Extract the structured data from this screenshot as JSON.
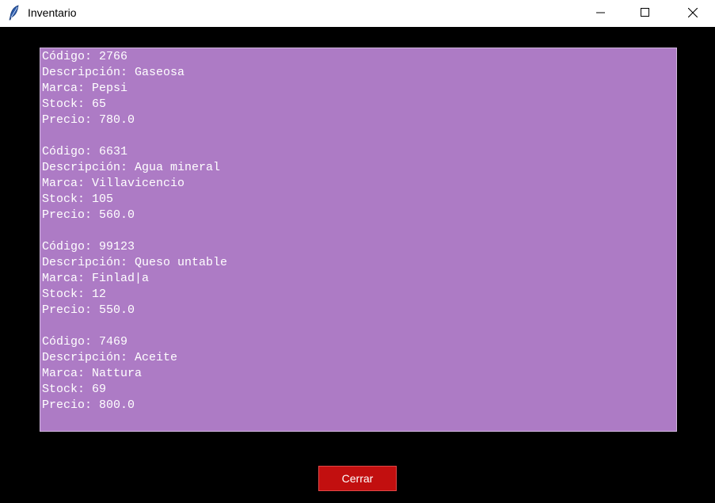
{
  "window": {
    "title": "Inventario",
    "icon": "tk-feather-icon"
  },
  "inventory": {
    "records": [
      {
        "code": "Código: 2766",
        "description": "Descripción: Gaseosa",
        "brand": "Marca: Pepsi",
        "stock": "Stock: 65",
        "price": "Precio: 780.0"
      },
      {
        "code": "Código: 6631",
        "description": "Descripción: Agua mineral",
        "brand": "Marca: Villavicencio",
        "stock": "Stock: 105",
        "price": "Precio: 560.0"
      },
      {
        "code": "Código: 99123",
        "description": "Descripción: Queso untable",
        "brand": "Marca: Finlad|a",
        "stock": "Stock: 12",
        "price": "Precio: 550.0"
      },
      {
        "code": "Código: 7469",
        "description": "Descripción: Aceite",
        "brand": "Marca: Nattura",
        "stock": "Stock: 69",
        "price": "Precio: 800.0"
      }
    ]
  },
  "buttons": {
    "close_label": "Cerrar"
  },
  "colors": {
    "text_area_bg": "#ad7bc5",
    "window_bg": "#000000",
    "close_button_bg": "#c20f0f"
  }
}
